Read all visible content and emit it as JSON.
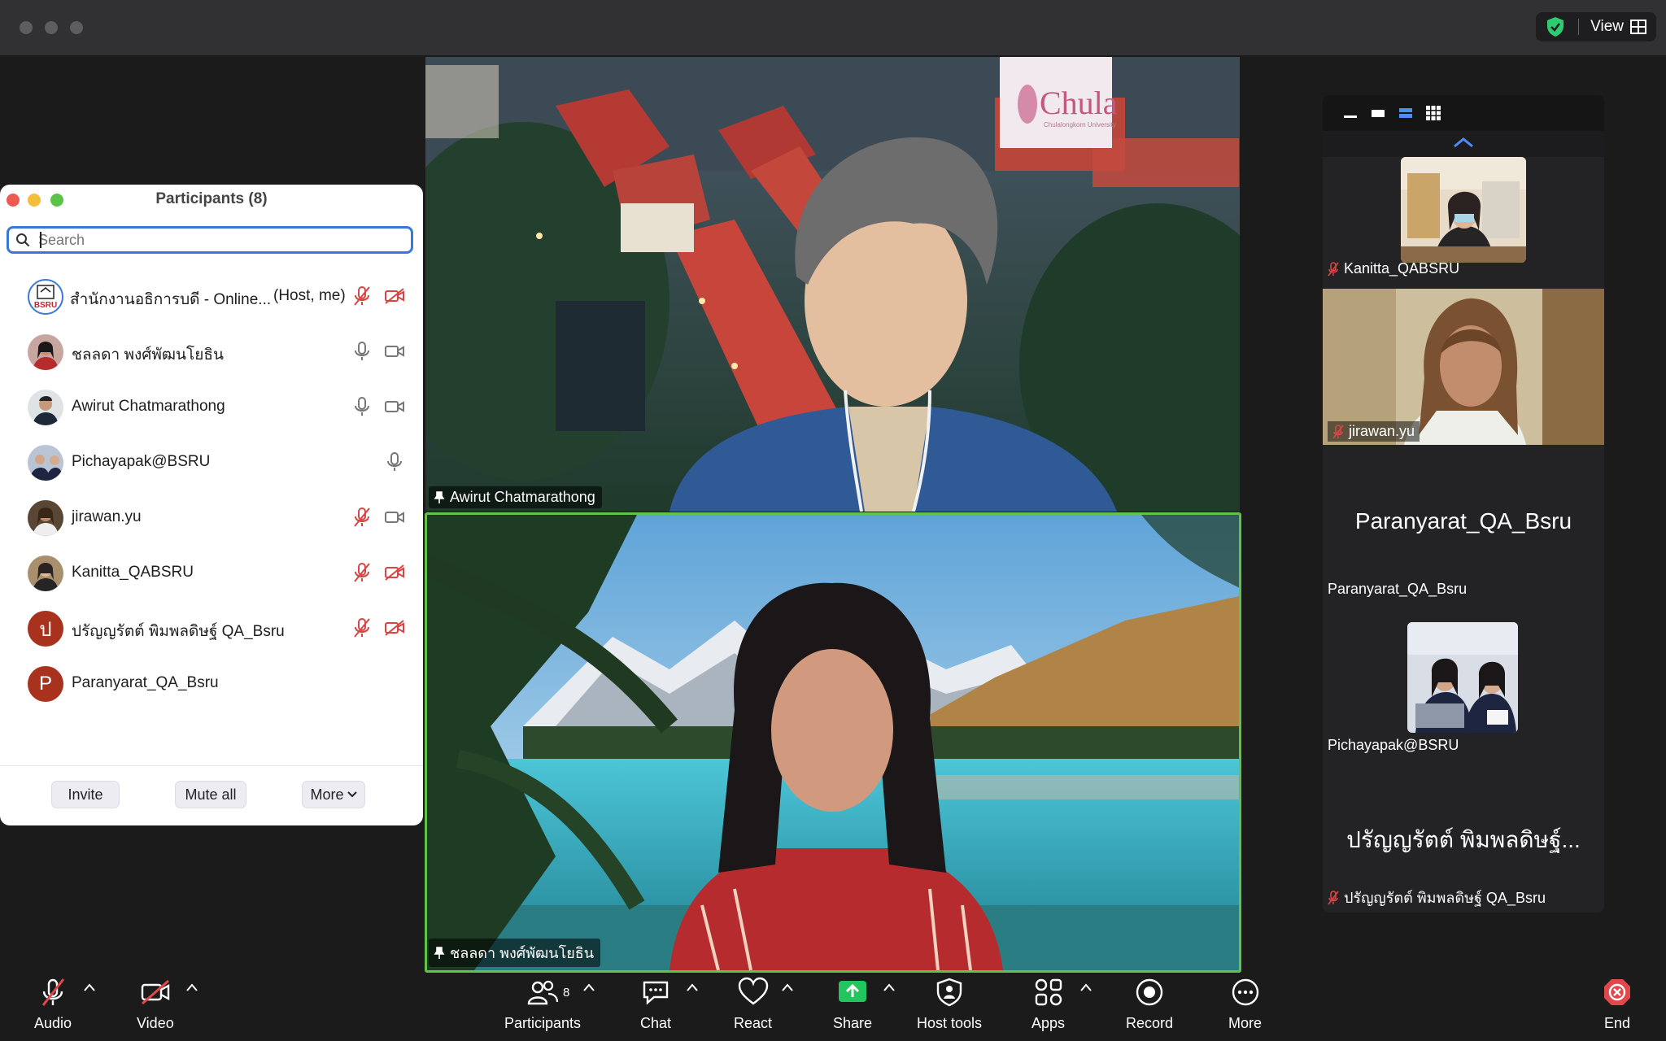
{
  "titlebar": {
    "view_label": "View",
    "security_icon": "shield-check-icon"
  },
  "videos": {
    "top": {
      "name": "Awirut Chatmarathong",
      "watermark": "Chula",
      "watermark_sub": "Chulalongkorn University"
    },
    "bottom": {
      "name": "ชลลดา พงศ์พัฒนโยธิน"
    }
  },
  "gallery": {
    "cells": [
      {
        "name": "Kanitta_QABSRU",
        "muted": true
      },
      {
        "name": "jirawan.yu",
        "muted": true
      },
      {
        "name": "Paranyarat_QA_Bsru",
        "big_name": "Paranyarat_QA_Bsru",
        "muted": false
      },
      {
        "name": "Pichayapak@BSRU",
        "muted": false
      },
      {
        "name": "ปรัญญรัตต์ พิมพลดิษฐ์ QA_Bsru",
        "big_name": "ปรัญญรัตต์ พิมพลดิษฐ์...",
        "muted": true
      }
    ]
  },
  "participants_panel": {
    "title": "Participants (8)",
    "search_placeholder": "Search",
    "participants": [
      {
        "name": "สำนักงานอธิการบดี - Online...",
        "role": "(Host, me)",
        "mic": "muted",
        "camera": "off"
      },
      {
        "name": "ชลลดา พงศ์พัฒนโยธิน",
        "role": "",
        "mic": "on",
        "camera": "on"
      },
      {
        "name": "Awirut Chatmarathong",
        "role": "",
        "mic": "on",
        "camera": "on"
      },
      {
        "name": "Pichayapak@BSRU",
        "role": "",
        "mic": "on",
        "camera": "none"
      },
      {
        "name": "jirawan.yu",
        "role": "",
        "mic": "muted",
        "camera": "on"
      },
      {
        "name": "Kanitta_QABSRU",
        "role": "",
        "mic": "muted",
        "camera": "off"
      },
      {
        "name": "ปรัญญรัตต์ พิมพลดิษฐ์ QA_Bsru",
        "role": "",
        "avatar_letter": "ป",
        "mic": "muted",
        "camera": "off"
      },
      {
        "name": "Paranyarat_QA_Bsru",
        "role": "",
        "avatar_letter": "P",
        "mic": "none",
        "camera": "none"
      }
    ],
    "buttons": {
      "invite": "Invite",
      "mute_all": "Mute all",
      "more": "More"
    }
  },
  "toolbar": {
    "audio": "Audio",
    "video": "Video",
    "participants": "Participants",
    "participants_count": "8",
    "chat": "Chat",
    "react": "React",
    "share": "Share",
    "host_tools": "Host tools",
    "apps": "Apps",
    "record": "Record",
    "more": "More",
    "end": "End"
  },
  "colors": {
    "active_speaker": "#62c24a",
    "muted_red": "#d84545",
    "share_green": "#22c55e",
    "search_focus": "#3a78d8"
  }
}
